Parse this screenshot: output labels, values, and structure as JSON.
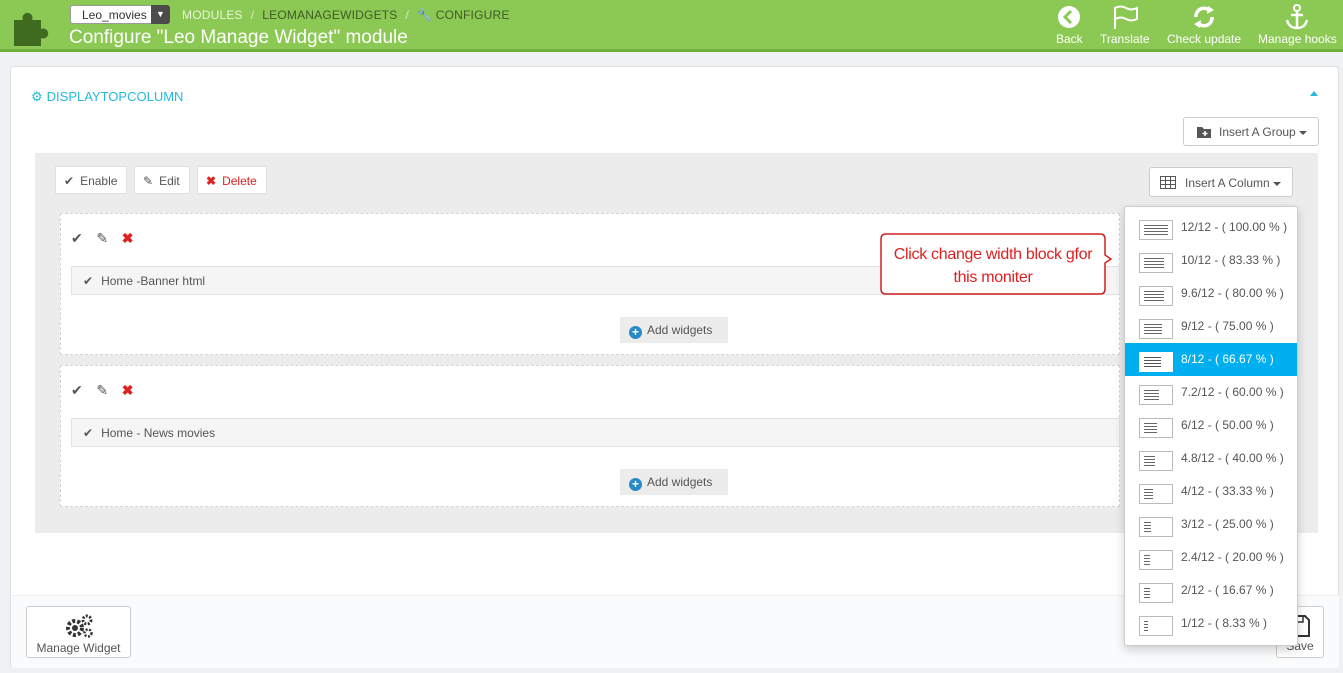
{
  "header": {
    "shop_name": "Leo_movies",
    "breadcrumb": [
      "MODULES",
      "LEOMANAGEWIDGETS",
      "CONFIGURE"
    ],
    "title": "Configure \"Leo Manage Widget\" module",
    "toolbar": {
      "back": "Back",
      "translate": "Translate",
      "check_update": "Check update",
      "manage_hooks": "Manage hooks"
    }
  },
  "panel": {
    "heading": "DISPLAYTOPCOLUMN",
    "insert_group": "Insert A Group",
    "group_buttons": {
      "enable": "Enable",
      "edit": "Edit",
      "delete": "Delete"
    },
    "insert_column": "Insert A Column",
    "columns": [
      {
        "widget": "Home -Banner html",
        "add_widgets": "Add widgets"
      },
      {
        "widget": "Home - News movies",
        "add_widgets": "Add widgets"
      }
    ]
  },
  "footer": {
    "manage_widget": "Manage Widget",
    "save": "Save"
  },
  "column_widths": [
    "12/12 - ( 100.00 % )",
    "10/12 - ( 83.33 % )",
    "9.6/12 - ( 80.00 % )",
    "9/12 - ( 75.00 % )",
    "8/12 - ( 66.67 % )",
    "7.2/12 - ( 60.00 % )",
    "6/12 - ( 50.00 % )",
    "4.8/12 - ( 40.00 % )",
    "4/12 - ( 33.33 % )",
    "3/12 - ( 25.00 % )",
    "2.4/12 - ( 20.00 % )",
    "2/12 - ( 16.67 % )",
    "1/12 - ( 8.33 % )"
  ],
  "selected_width": "8/12 - ( 66.67 % )",
  "callout": {
    "line1": "Click change width block gfor",
    "line2": "this moniter"
  },
  "colors": {
    "header": "#8bc954",
    "accent": "#25b9d7",
    "active": "#00aff0",
    "delete": "#e02020"
  }
}
